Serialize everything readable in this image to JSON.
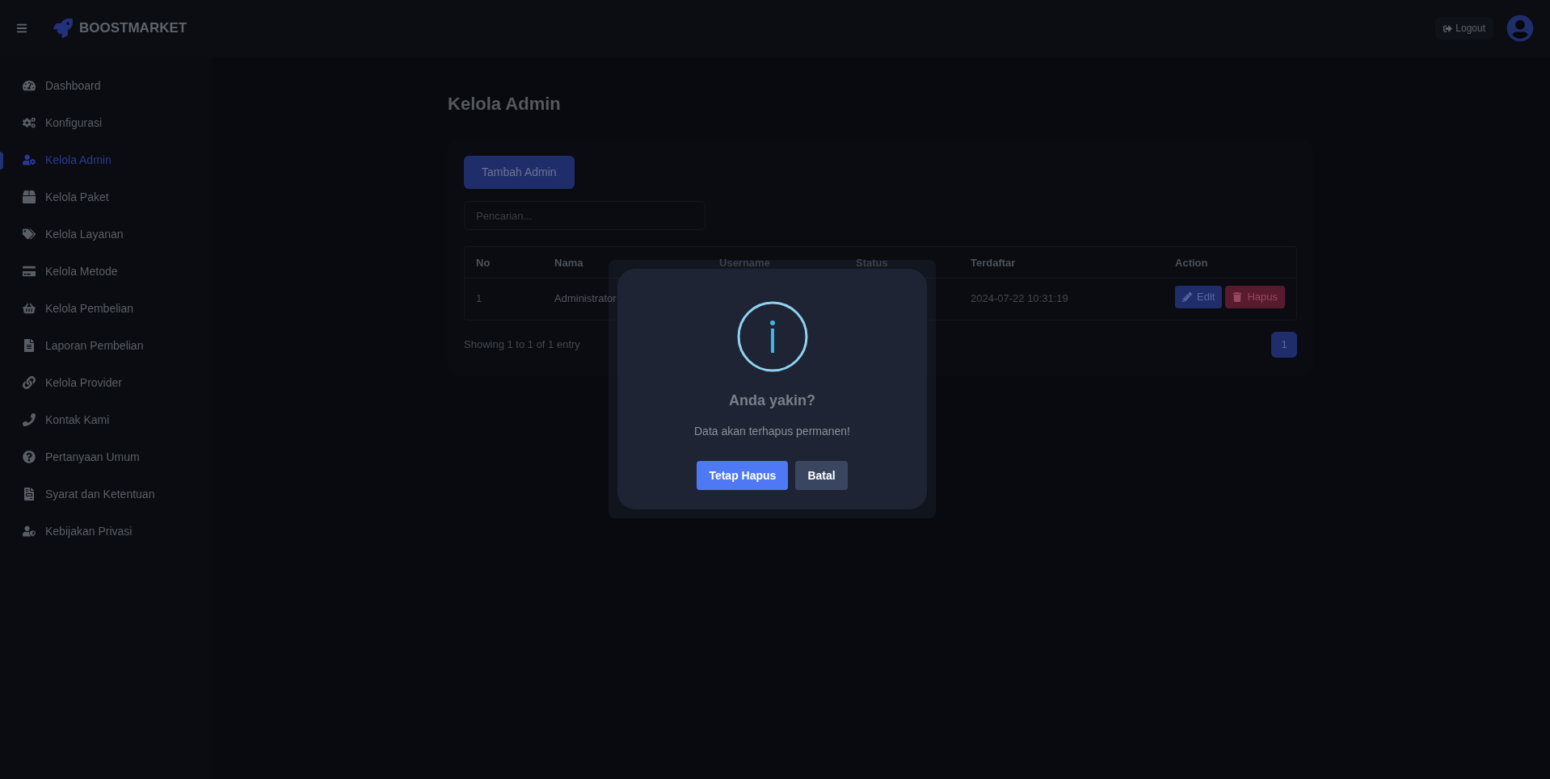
{
  "header": {
    "brand": "BOOSTMARKET",
    "logout": "Logout"
  },
  "sidebar": {
    "items": [
      {
        "label": "Dashboard",
        "selected": false
      },
      {
        "label": "Konfigurasi",
        "selected": false
      },
      {
        "label": "Kelola Admin",
        "selected": true
      },
      {
        "label": "Kelola Paket",
        "selected": false
      },
      {
        "label": "Kelola Layanan",
        "selected": false
      },
      {
        "label": "Kelola Metode",
        "selected": false
      },
      {
        "label": "Kelola Pembelian",
        "selected": false
      },
      {
        "label": "Laporan Pembelian",
        "selected": false
      },
      {
        "label": "Kelola Provider",
        "selected": false
      },
      {
        "label": "Kontak Kami",
        "selected": false
      },
      {
        "label": "Pertanyaan Umum",
        "selected": false
      },
      {
        "label": "Syarat dan Ketentuan",
        "selected": false
      },
      {
        "label": "Kebijakan Privasi",
        "selected": false
      }
    ]
  },
  "page": {
    "title": "Kelola Admin",
    "add_button": "Tambah Admin",
    "search": {
      "placeholder": "Pencarian..."
    }
  },
  "table": {
    "columns": [
      "No",
      "Nama",
      "Username",
      "Status",
      "Terdaftar",
      "Action"
    ],
    "rows": [
      {
        "no": "1",
        "nama": "Administrator",
        "terdaftar": "2024-07-22 10:31:19",
        "actions": [
          {
            "kind": "edit",
            "label": "Edit"
          },
          {
            "kind": "delete",
            "label": "Hapus"
          }
        ]
      }
    ]
  },
  "footer": {
    "info": "Showing 1 to 1 of 1 entry",
    "pages": [
      {
        "label": "1",
        "selected": true
      }
    ]
  },
  "dialog": {
    "title": "Anda yakin?",
    "message": "Data akan terhapus permanen!",
    "buttons": [
      {
        "kind": "confirm",
        "label": "Tetap Hapus"
      },
      {
        "kind": "cancel",
        "label": "Batal"
      }
    ]
  }
}
